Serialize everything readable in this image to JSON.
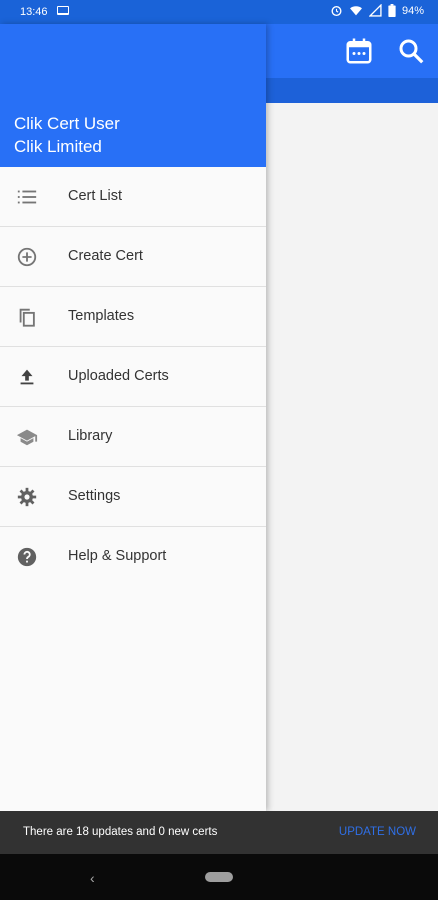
{
  "status_bar": {
    "time": "13:46",
    "battery": "94%"
  },
  "drawer": {
    "user_name": "Clik Cert User",
    "company": "Clik Limited",
    "items": [
      {
        "label": "Cert List",
        "icon": "list-icon"
      },
      {
        "label": "Create Cert",
        "icon": "add-circle-icon"
      },
      {
        "label": "Templates",
        "icon": "copy-icon"
      },
      {
        "label": "Uploaded Certs",
        "icon": "upload-icon"
      },
      {
        "label": "Library",
        "icon": "school-icon"
      },
      {
        "label": "Settings",
        "icon": "gear-icon"
      },
      {
        "label": "Help & Support",
        "icon": "help-icon"
      }
    ]
  },
  "snackbar": {
    "message": "There are 18 updates and 0 new certs",
    "action": "UPDATE NOW"
  },
  "colors": {
    "primary": "#2870f6",
    "status": "#1a63d8",
    "accent": "#2f6fe6"
  }
}
